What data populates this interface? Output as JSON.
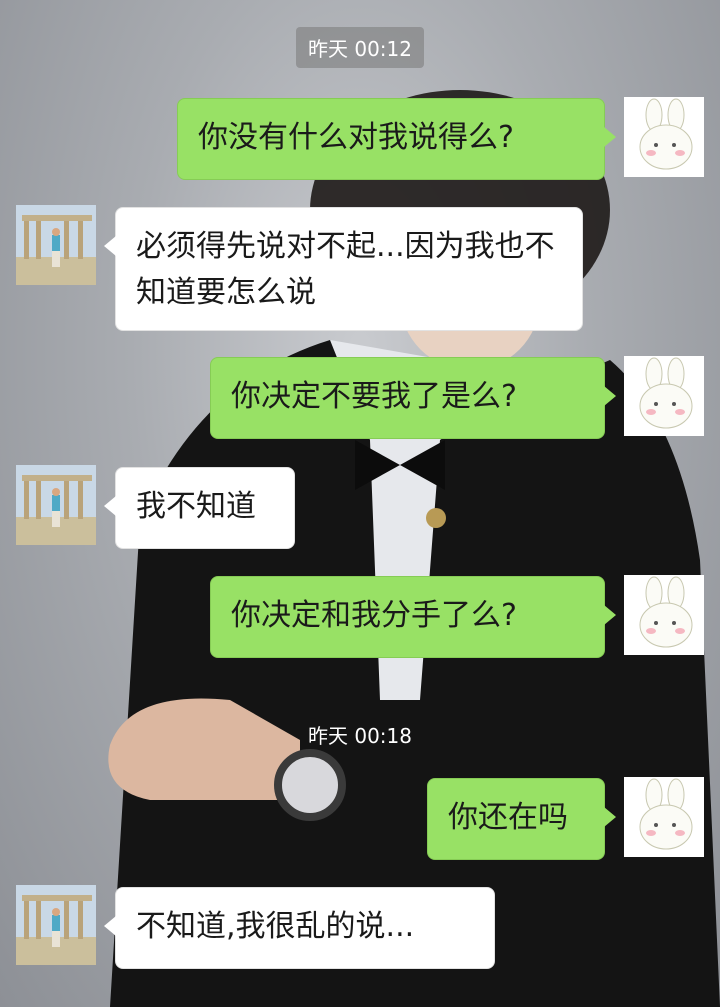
{
  "conversation": {
    "timestamps": [
      "昨天 00:12",
      "昨天 00:18"
    ],
    "messages": [
      {
        "side": "out",
        "text": "你没有什么对我说得么?"
      },
      {
        "side": "in",
        "text": "必须得先说对不起...因为我也不知道要怎么说"
      },
      {
        "side": "out",
        "text": "你决定不要我了是么?"
      },
      {
        "side": "in",
        "text": "我不知道"
      },
      {
        "side": "out",
        "text": "你决定和我分手了么?"
      },
      {
        "side": "out",
        "text": "你还在吗"
      },
      {
        "side": "in",
        "text": "不知道,我很乱的说..."
      }
    ]
  },
  "avatars": {
    "self": "bunny-avatar-icon",
    "contact": "ruins-photo-avatar"
  },
  "colors": {
    "outgoing_bubble": "#98e165",
    "incoming_bubble": "#ffffff",
    "timestamp_text": "#ffffff"
  }
}
